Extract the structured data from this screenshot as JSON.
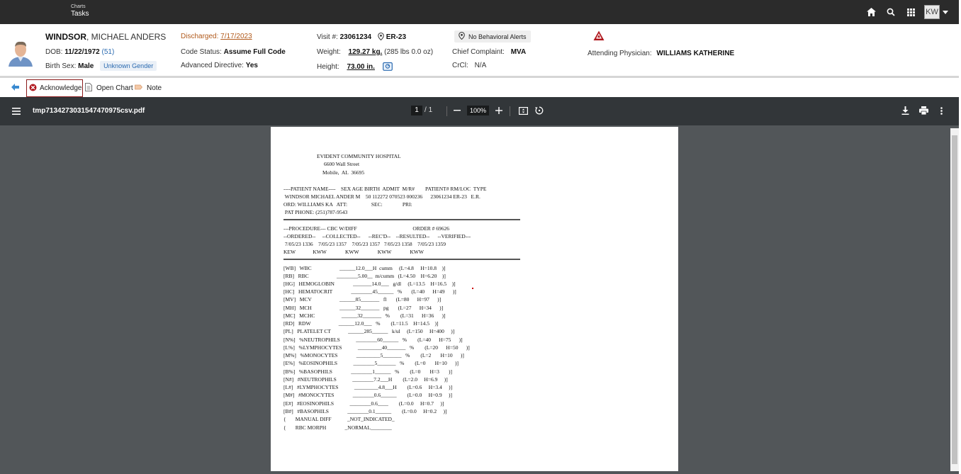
{
  "topbar": {
    "nav_small": "Charts",
    "nav_main": "Tasks",
    "user_initials": "KW",
    "icons": [
      "home-icon",
      "search-icon",
      "apps-grid-icon"
    ]
  },
  "patient": {
    "last_name": "WINDSOR",
    "first_names": ", MICHAEL ANDERS",
    "dob_label": "DOB:",
    "dob": "11/22/1972",
    "age": "(51)",
    "sex_label": "Birth Sex:",
    "sex": "Male",
    "gender": "Unknown Gender",
    "discharged_label": "Discharged:",
    "discharged_date": "7/17/2023",
    "code_status_label": "Code Status:",
    "code_status": "Assume Full Code",
    "adv_dir_label": "Advanced Directive:",
    "adv_dir": "Yes",
    "visit_label": "Visit #:",
    "visit": "23061234",
    "location": "ER-23",
    "weight_label": "Weight:",
    "weight": "129.27 kg.",
    "weight_lbs": "(285 lbs 0.0 oz)",
    "height_label": "Height:",
    "height": "73.00 in.",
    "behavioral_alert": "No Behavioral Alerts",
    "complaint_label": "Chief Complaint:",
    "complaint": "MVA",
    "crcl_label": "CrCl:",
    "crcl": "N/A",
    "attending_label": "Attending Physician:",
    "attending": "WILLIAMS KATHERINE"
  },
  "actions": {
    "acknowledge": "Acknowledge",
    "open_chart": "Open Chart",
    "note": "Note"
  },
  "pdf": {
    "filename": "tmp7134273031547470975csv.pdf",
    "page": "1",
    "page_sep": "/",
    "page_total": "1",
    "zoom": "100%"
  },
  "report": {
    "lines": [
      "EVIDENT COMMUNITY HOSPITAL",
      "6600 Wall Street",
      "Mobile,  AL  36695",
      "----PATIENT NAME----    SEX AGE BIRTH  ADMIT  M/R#        PATIENT# RM/LOC  TYPE",
      " WINDSOR MICHAEL ANDER M    50 112272 070523 000236      23061234 ER-23   E.R.",
      "ORD: WILLIAMS KA   ATT:                  SEC:               PRI:",
      " PAT PHONE: (251)787-9543",
      "---PROCEDURE--- CBC W/DIFF                                          ORDER # 69626",
      "--ORDERED--     --COLLECTED--      --REC'D--    --RESULTED--      --VERIFIED---",
      " 7/05/23 1336    7/05/23 1357    7/05/23 1357   7/05/23 1358    7/05/23 1359",
      "KEW             KWW              KWW              KWW              KWW",
      "[WB]   WBC                     ______12.0___H  cumm     (L=4.8     H=10.8    )]",
      "[RB]   RBC                     ________5.00__  m/cumm   (L=4.50    H=6.20    )]",
      "[HG]   HEMOGLOBIN              _______14.0___   g/dl     (L=13.5    H=16.5    )]",
      "[HC]   HEMATOCRIT              ________45______   %       (L=40      H=49      )]",
      "[MV]   MCV                     ______85_______   fl       (L=80      H=97      )]",
      "[MH]   MCH                     ______32_______   pg       (L=27      H=34      )]",
      "[MC]   MCHC                    ______32_______   %        (L=31      H=36      )]",
      "[RD]   RDW                     ______12.0___   %        (L=11.5    H=14.5    )]",
      "[PL]   PLATELET CT             ______285______   k/ul     (L=150     H=400     )]",
      "[N%]   %NEUTROPHILS            ________60______   %        (L=40      H=75      )]",
      "[L%]   %LYMPHOCYTES            _________40_______   %        (L=20      H=50      )]",
      "[M%]   %MONOCYTES              _________5_______   %        (L=2       H=10      )]",
      "[E%]   %EOSINOPHILS            ________5_______   %        (L=0       H=10      )]",
      "[B%]   %BASOPHILS              ________1______   %        (L=0       H=3       )]",
      "[N#]   #NEUTROPHILS            ________7.2___H        (L=2.0     H=6.9     )]",
      "[L#]   #LYMPHOCYTES            _________4.8___H        (L=0.6     H=3.4     )]",
      "[M#]   #MONOCYTES              ________0.6______        (L=0.0     H=0.9     )]",
      "[E#]   #EOSINOPHILS            ________0.6____        (L=0.0     H=0.7     )]",
      "[B#]   #BASOPHILS              ________0.1______        (L=0.0     H=0.2     )]",
      "{       MANUAL DIFF            _NOT_INDICATED_",
      "{       RBC MORPH              _NORMAL________"
    ]
  }
}
